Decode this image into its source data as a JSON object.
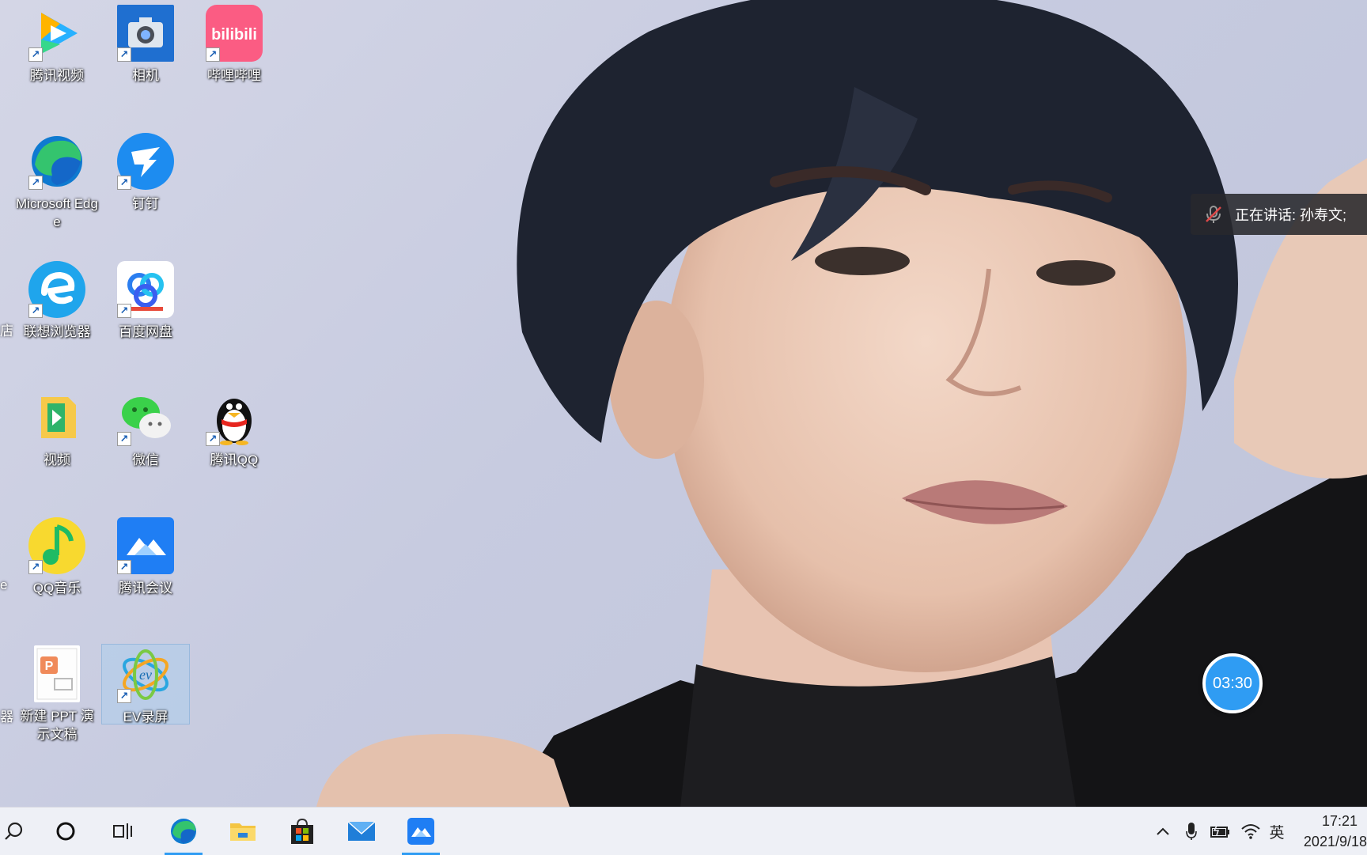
{
  "desktop": {
    "icons": [
      {
        "label": "腾讯视频",
        "name": "tencent-video"
      },
      {
        "label": "相机",
        "name": "camera"
      },
      {
        "label": "哔哩哔哩",
        "name": "bilibili",
        "logo_text": "bilibili"
      },
      {
        "label": "Microsoft Edge",
        "name": "microsoft-edge"
      },
      {
        "label": "钉钉",
        "name": "dingtalk"
      },
      {
        "label": "联想浏览器",
        "name": "lenovo-browser"
      },
      {
        "label": "百度网盘",
        "name": "baidu-netdisk"
      },
      {
        "label": "视频",
        "name": "video"
      },
      {
        "label": "微信",
        "name": "wechat"
      },
      {
        "label": "腾讯QQ",
        "name": "tencent-qq"
      },
      {
        "label": "QQ音乐",
        "name": "qq-music"
      },
      {
        "label": "腾讯会议",
        "name": "tencent-meeting"
      },
      {
        "label": "新建 PPT 演示文稿",
        "name": "new-ppt"
      },
      {
        "label": "EV录屏",
        "name": "ev-recorder",
        "selected": true
      }
    ],
    "edge_clipped_labels": [
      "店",
      "e",
      "器"
    ]
  },
  "meeting_overlay": {
    "speaking_text": "正在讲话: 孙寿文;",
    "timer": "03:30"
  },
  "taskbar": {
    "pinned": [
      "search-icon",
      "cortana-icon",
      "task-view-icon",
      "edge-icon",
      "file-explorer-icon",
      "microsoft-store-icon",
      "mail-icon",
      "tencent-meeting-icon"
    ],
    "active": "tencent-meeting-icon",
    "tray": {
      "ime_label": "英",
      "time": "17:21",
      "date": "2021/9/18"
    }
  },
  "colors": {
    "accent": "#2f9cf3",
    "taskbar_bg": "#eef0f6",
    "toast_bg": "#28282c"
  }
}
